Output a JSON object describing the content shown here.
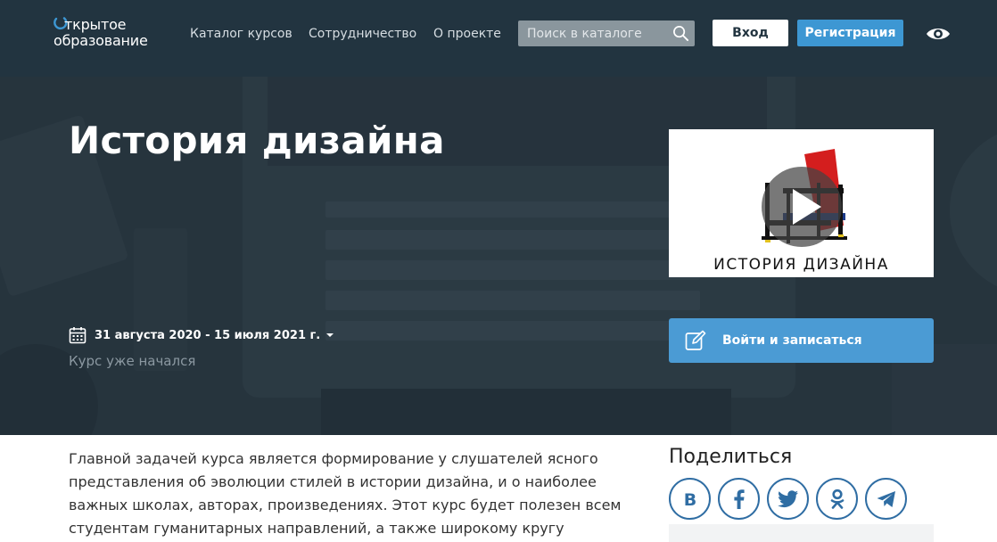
{
  "header": {
    "logo_line1": "ткрытое",
    "logo_line2": "образование",
    "nav": [
      {
        "label": "Каталог курсов"
      },
      {
        "label": "Сотрудничество"
      },
      {
        "label": "О проекте"
      }
    ],
    "search_placeholder": "Поиск в каталоге",
    "login_label": "Вход",
    "register_label": "Регистрация"
  },
  "hero": {
    "title": "История дизайна",
    "dates": "31 августа 2020 - 15 июля 2021 г.",
    "status": "Курс уже начался",
    "video_caption": "ИСТОРИЯ ДИЗАЙНА",
    "enroll_label": "Войти и записаться"
  },
  "content": {
    "description": "Главной задачей курса является формирование у слушателей ясного представления об эволюции стилей в истории дизайна, и о наиболее важных школах, авторах, произведениях. Этот курс будет полезен всем студентам гуманитарных направлений, а также широкому кругу"
  },
  "share": {
    "title": "Поделиться",
    "networks": [
      "vk-icon",
      "facebook-icon",
      "twitter-icon",
      "odnoklassniki-icon",
      "telegram-icon"
    ]
  },
  "colors": {
    "header_bg": "#223440",
    "accent": "#3d97d3",
    "enroll": "#4b9bd4",
    "share_border": "#2f6da3"
  }
}
